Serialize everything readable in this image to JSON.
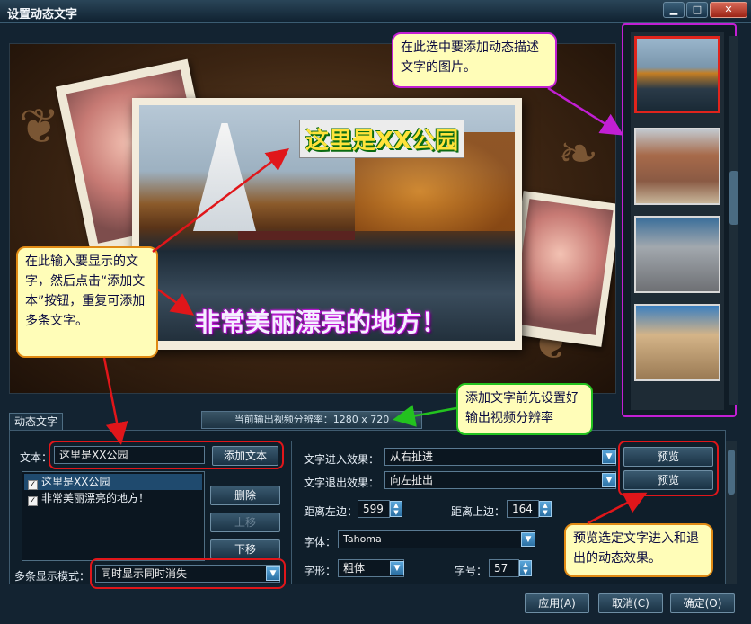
{
  "window": {
    "title": "设置动态文字",
    "min": "▁",
    "max": "□",
    "close": "✕"
  },
  "overlay": {
    "line1": "这里是XX公园",
    "line2": "非常美丽漂亮的地方！"
  },
  "resolution": {
    "label": "当前输出视频分辨率：",
    "value": "1280 x 720"
  },
  "tab": "动态文字",
  "text": {
    "label": "文本：",
    "value": "这里是XX公园",
    "add_label": "添加文本"
  },
  "list": {
    "items": [
      {
        "label": "这里是XX公园",
        "checked": true
      },
      {
        "label": "非常美丽漂亮的地方！",
        "checked": true
      }
    ]
  },
  "side_buttons": {
    "delete": "删除",
    "up": "上移",
    "down": "下移"
  },
  "multi_mode": {
    "label": "多条显示模式：",
    "value": "同时显示同时消失"
  },
  "effects": {
    "enter_label": "文字进入效果：",
    "enter_value": "从右扯进",
    "exit_label": "文字退出效果：",
    "exit_value": "向左扯出",
    "preview": "预览"
  },
  "position": {
    "left_label": "距离左边：",
    "left_value": "599",
    "top_label": "距离上边：",
    "top_value": "164"
  },
  "font": {
    "label": "字体：",
    "value": "Tahoma",
    "style_label": "字形：",
    "style_value": "粗体",
    "size_label": "字号：",
    "size_value": "57"
  },
  "footer": {
    "apply": "应用(A)",
    "cancel": "取消(C)",
    "ok": "确定(O)"
  },
  "annotations": {
    "pick": "在此选中要添加动态描述文字的图片。",
    "input": "在此输入要显示的文字，然后点击“添加文本”按钮，重复可添加多条文字。",
    "res": "添加文字前先设置好输出视频分辨率",
    "preview": "预览选定文字进入和退出的动态效果。"
  },
  "colors": {
    "ann_magenta": "#c21fd4",
    "ann_green": "#23c21f",
    "ann_red": "#e0161a",
    "ann_orange": "#e08a14"
  }
}
